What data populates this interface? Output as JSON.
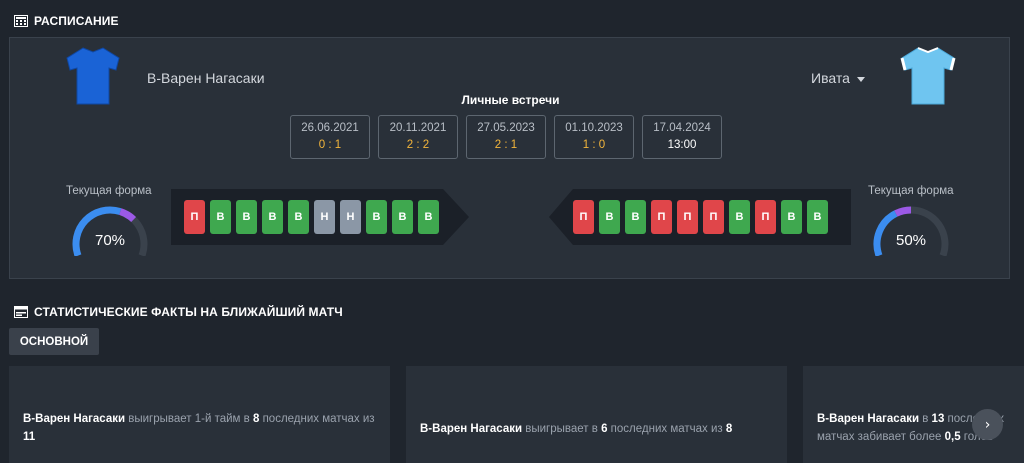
{
  "schedule": {
    "title": "РАСПИСАНИЕ",
    "home_team": {
      "name": "В-Варен Нагасаки",
      "shirt_color": "#1a63d6"
    },
    "away_team": {
      "name": "Ивата",
      "shirt_color": "#6fc5f0"
    },
    "h2h_title": "Личные встречи",
    "h2h": [
      {
        "date": "26.06.2021",
        "score": "0 : 1"
      },
      {
        "date": "20.11.2021",
        "score": "2 : 2"
      },
      {
        "date": "27.05.2023",
        "score": "2 : 1"
      },
      {
        "date": "01.10.2023",
        "score": "1 : 0"
      },
      {
        "date": "17.04.2024",
        "score": "13:00"
      }
    ],
    "home_form": {
      "label": "Текущая форма",
      "percent": "70%",
      "value": 70,
      "results": [
        "П",
        "В",
        "В",
        "В",
        "В",
        "Н",
        "Н",
        "В",
        "В",
        "В"
      ]
    },
    "away_form": {
      "label": "Текущая форма",
      "percent": "50%",
      "value": 50,
      "results": [
        "П",
        "В",
        "В",
        "П",
        "П",
        "П",
        "В",
        "П",
        "В",
        "В"
      ]
    },
    "colors": {
      "win": "#3fa84f",
      "loss": "#e0464a",
      "draw": "#8b97a6",
      "score": "#f3b53b"
    }
  },
  "facts": {
    "title": "СТАТИСТИЧЕСКИЕ ФАКТЫ НА БЛИЖАЙШИЙ МАТЧ",
    "tab_label": "ОСНОВНОЙ",
    "cards": [
      {
        "team": "В-Варен Нагасаки",
        "t1": " выигрывает 1-й тайм в ",
        "n1": "8",
        "t2": " последних матчах из ",
        "n2": "11",
        "t3": ""
      },
      {
        "team": "В-Варен Нагасаки",
        "t1": " выигрывает в ",
        "n1": "6",
        "t2": " последних матчах из ",
        "n2": "8",
        "t3": ""
      },
      {
        "team": "В-Варен Нагасаки",
        "t1": " в ",
        "n1": "13",
        "t2": " последних матчах забивает более ",
        "n2": "0,5",
        "t3": " голов"
      }
    ],
    "next_icon": "chevron-right-icon"
  }
}
